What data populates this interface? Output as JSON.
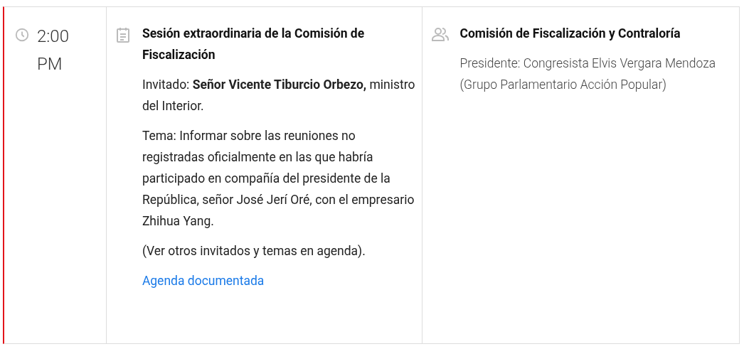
{
  "time": [
    "2:00",
    "PM"
  ],
  "session": {
    "title": "Sesión extraordinaria de la Comisión de Fiscalización",
    "paragraphs": [
      "Invitado: **Señor Vicente Tiburcio Orbezo,** ministro del Interior.",
      "Tema: Informar sobre las reuniones no registradas oficialmente en las que habría participado en compañía del presidente de la República, señor José Jerí Oré, con el empresario Zhihua Yang.",
      "(Ver otros invitados y temas en agenda)."
    ],
    "link": "Agenda documentada"
  },
  "committee": {
    "name": "Comisión de Fiscalización y Contraloría",
    "president": "Presidente: Congresista Elvis Vergara Mendoza (Grupo Parlamentario Acción Popular)"
  }
}
